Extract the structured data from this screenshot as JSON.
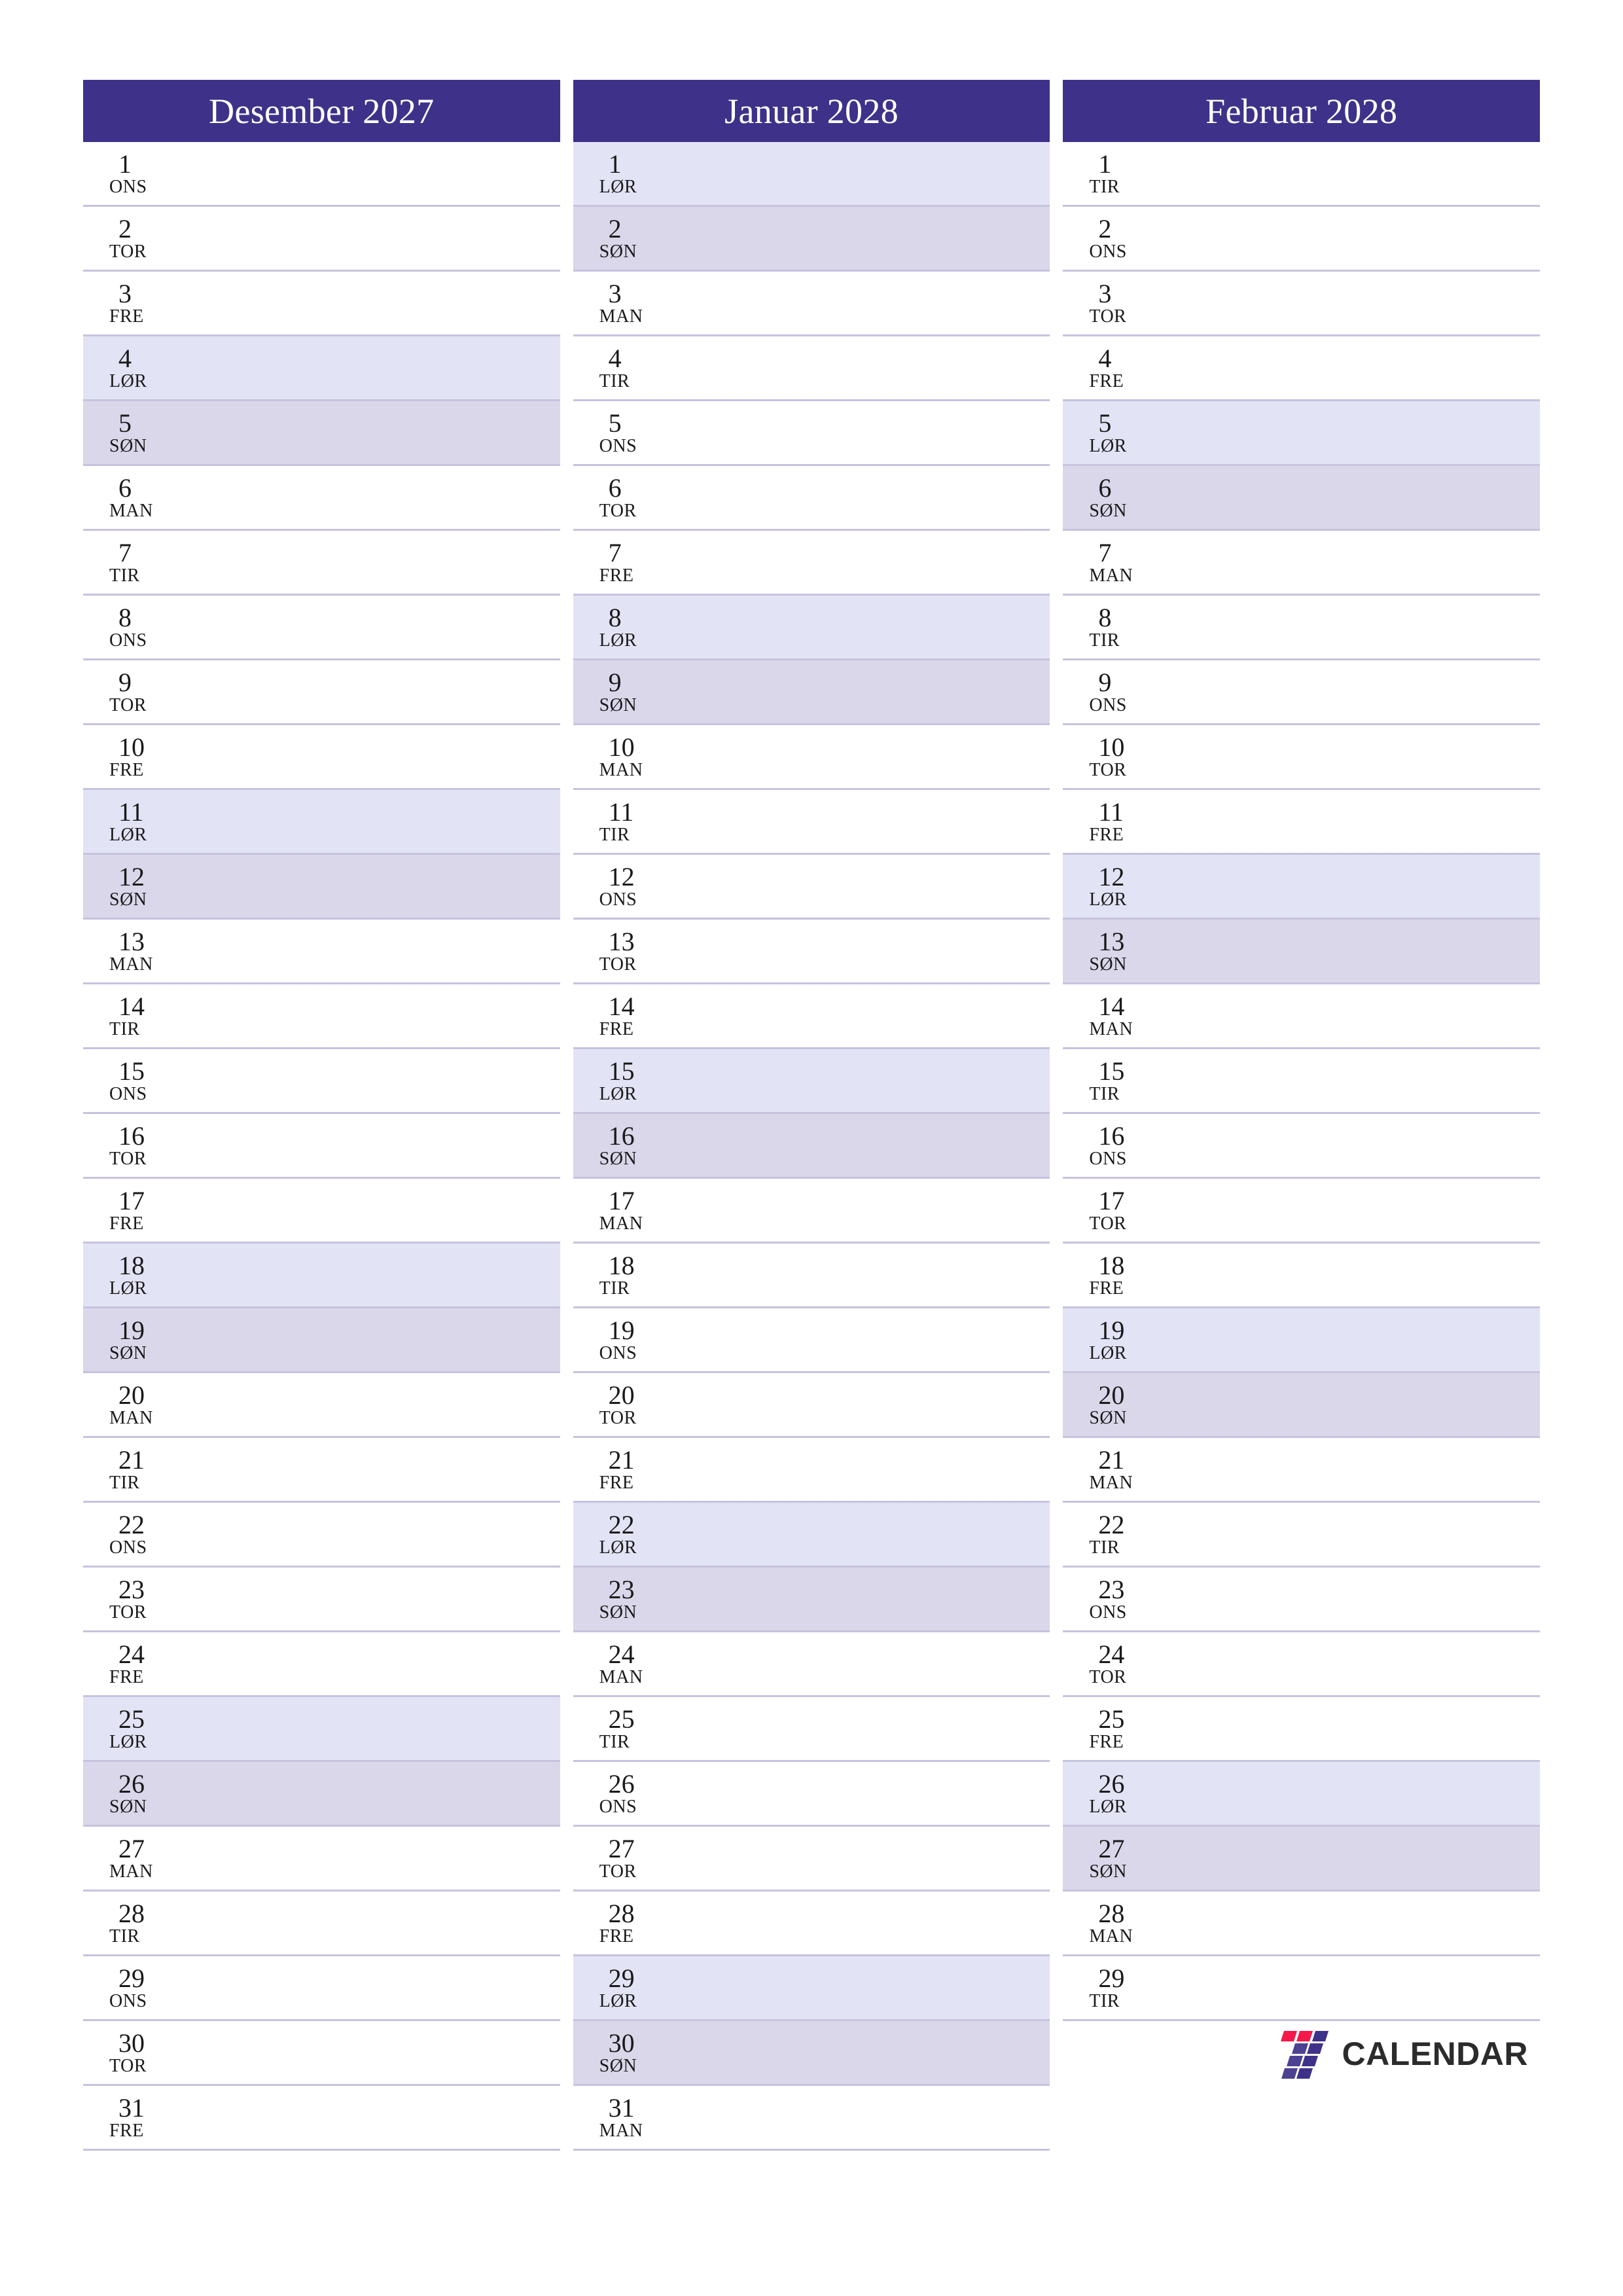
{
  "document": {
    "type": "monthly-planner-calendar",
    "language": "no",
    "orientation": "portrait"
  },
  "theme": {
    "header_bg": "#3e3189",
    "header_text": "#ffffff",
    "saturday_bg": "#e3e3f6",
    "sunday_bg": "#dad7ea",
    "row_separator": "#c5c3de",
    "body_text": "#1a1a1a",
    "logo_red": "#f5184a",
    "logo_indigo": "#3e3189",
    "logo_text": "#2b2b2b"
  },
  "logo": {
    "mark_name": "seven-stripes-mark",
    "text": "CALENDAR"
  },
  "months": [
    {
      "title": "Desember 2027",
      "name": "Desember",
      "year": "2027",
      "days": [
        {
          "num": "1",
          "weekday": "ONS",
          "kind": "weekday"
        },
        {
          "num": "2",
          "weekday": "TOR",
          "kind": "weekday"
        },
        {
          "num": "3",
          "weekday": "FRE",
          "kind": "weekday"
        },
        {
          "num": "4",
          "weekday": "LØR",
          "kind": "sat"
        },
        {
          "num": "5",
          "weekday": "SØN",
          "kind": "sun"
        },
        {
          "num": "6",
          "weekday": "MAN",
          "kind": "weekday"
        },
        {
          "num": "7",
          "weekday": "TIR",
          "kind": "weekday"
        },
        {
          "num": "8",
          "weekday": "ONS",
          "kind": "weekday"
        },
        {
          "num": "9",
          "weekday": "TOR",
          "kind": "weekday"
        },
        {
          "num": "10",
          "weekday": "FRE",
          "kind": "weekday"
        },
        {
          "num": "11",
          "weekday": "LØR",
          "kind": "sat"
        },
        {
          "num": "12",
          "weekday": "SØN",
          "kind": "sun"
        },
        {
          "num": "13",
          "weekday": "MAN",
          "kind": "weekday"
        },
        {
          "num": "14",
          "weekday": "TIR",
          "kind": "weekday"
        },
        {
          "num": "15",
          "weekday": "ONS",
          "kind": "weekday"
        },
        {
          "num": "16",
          "weekday": "TOR",
          "kind": "weekday"
        },
        {
          "num": "17",
          "weekday": "FRE",
          "kind": "weekday"
        },
        {
          "num": "18",
          "weekday": "LØR",
          "kind": "sat"
        },
        {
          "num": "19",
          "weekday": "SØN",
          "kind": "sun"
        },
        {
          "num": "20",
          "weekday": "MAN",
          "kind": "weekday"
        },
        {
          "num": "21",
          "weekday": "TIR",
          "kind": "weekday"
        },
        {
          "num": "22",
          "weekday": "ONS",
          "kind": "weekday"
        },
        {
          "num": "23",
          "weekday": "TOR",
          "kind": "weekday"
        },
        {
          "num": "24",
          "weekday": "FRE",
          "kind": "weekday"
        },
        {
          "num": "25",
          "weekday": "LØR",
          "kind": "sat"
        },
        {
          "num": "26",
          "weekday": "SØN",
          "kind": "sun"
        },
        {
          "num": "27",
          "weekday": "MAN",
          "kind": "weekday"
        },
        {
          "num": "28",
          "weekday": "TIR",
          "kind": "weekday"
        },
        {
          "num": "29",
          "weekday": "ONS",
          "kind": "weekday"
        },
        {
          "num": "30",
          "weekday": "TOR",
          "kind": "weekday"
        },
        {
          "num": "31",
          "weekday": "FRE",
          "kind": "weekday"
        }
      ]
    },
    {
      "title": "Januar 2028",
      "name": "Januar",
      "year": "2028",
      "days": [
        {
          "num": "1",
          "weekday": "LØR",
          "kind": "sat"
        },
        {
          "num": "2",
          "weekday": "SØN",
          "kind": "sun"
        },
        {
          "num": "3",
          "weekday": "MAN",
          "kind": "weekday"
        },
        {
          "num": "4",
          "weekday": "TIR",
          "kind": "weekday"
        },
        {
          "num": "5",
          "weekday": "ONS",
          "kind": "weekday"
        },
        {
          "num": "6",
          "weekday": "TOR",
          "kind": "weekday"
        },
        {
          "num": "7",
          "weekday": "FRE",
          "kind": "weekday"
        },
        {
          "num": "8",
          "weekday": "LØR",
          "kind": "sat"
        },
        {
          "num": "9",
          "weekday": "SØN",
          "kind": "sun"
        },
        {
          "num": "10",
          "weekday": "MAN",
          "kind": "weekday"
        },
        {
          "num": "11",
          "weekday": "TIR",
          "kind": "weekday"
        },
        {
          "num": "12",
          "weekday": "ONS",
          "kind": "weekday"
        },
        {
          "num": "13",
          "weekday": "TOR",
          "kind": "weekday"
        },
        {
          "num": "14",
          "weekday": "FRE",
          "kind": "weekday"
        },
        {
          "num": "15",
          "weekday": "LØR",
          "kind": "sat"
        },
        {
          "num": "16",
          "weekday": "SØN",
          "kind": "sun"
        },
        {
          "num": "17",
          "weekday": "MAN",
          "kind": "weekday"
        },
        {
          "num": "18",
          "weekday": "TIR",
          "kind": "weekday"
        },
        {
          "num": "19",
          "weekday": "ONS",
          "kind": "weekday"
        },
        {
          "num": "20",
          "weekday": "TOR",
          "kind": "weekday"
        },
        {
          "num": "21",
          "weekday": "FRE",
          "kind": "weekday"
        },
        {
          "num": "22",
          "weekday": "LØR",
          "kind": "sat"
        },
        {
          "num": "23",
          "weekday": "SØN",
          "kind": "sun"
        },
        {
          "num": "24",
          "weekday": "MAN",
          "kind": "weekday"
        },
        {
          "num": "25",
          "weekday": "TIR",
          "kind": "weekday"
        },
        {
          "num": "26",
          "weekday": "ONS",
          "kind": "weekday"
        },
        {
          "num": "27",
          "weekday": "TOR",
          "kind": "weekday"
        },
        {
          "num": "28",
          "weekday": "FRE",
          "kind": "weekday"
        },
        {
          "num": "29",
          "weekday": "LØR",
          "kind": "sat"
        },
        {
          "num": "30",
          "weekday": "SØN",
          "kind": "sun"
        },
        {
          "num": "31",
          "weekday": "MAN",
          "kind": "weekday"
        }
      ]
    },
    {
      "title": "Februar 2028",
      "name": "Februar",
      "year": "2028",
      "days": [
        {
          "num": "1",
          "weekday": "TIR",
          "kind": "weekday"
        },
        {
          "num": "2",
          "weekday": "ONS",
          "kind": "weekday"
        },
        {
          "num": "3",
          "weekday": "TOR",
          "kind": "weekday"
        },
        {
          "num": "4",
          "weekday": "FRE",
          "kind": "weekday"
        },
        {
          "num": "5",
          "weekday": "LØR",
          "kind": "sat"
        },
        {
          "num": "6",
          "weekday": "SØN",
          "kind": "sun"
        },
        {
          "num": "7",
          "weekday": "MAN",
          "kind": "weekday"
        },
        {
          "num": "8",
          "weekday": "TIR",
          "kind": "weekday"
        },
        {
          "num": "9",
          "weekday": "ONS",
          "kind": "weekday"
        },
        {
          "num": "10",
          "weekday": "TOR",
          "kind": "weekday"
        },
        {
          "num": "11",
          "weekday": "FRE",
          "kind": "weekday"
        },
        {
          "num": "12",
          "weekday": "LØR",
          "kind": "sat"
        },
        {
          "num": "13",
          "weekday": "SØN",
          "kind": "sun"
        },
        {
          "num": "14",
          "weekday": "MAN",
          "kind": "weekday"
        },
        {
          "num": "15",
          "weekday": "TIR",
          "kind": "weekday"
        },
        {
          "num": "16",
          "weekday": "ONS",
          "kind": "weekday"
        },
        {
          "num": "17",
          "weekday": "TOR",
          "kind": "weekday"
        },
        {
          "num": "18",
          "weekday": "FRE",
          "kind": "weekday"
        },
        {
          "num": "19",
          "weekday": "LØR",
          "kind": "sat"
        },
        {
          "num": "20",
          "weekday": "SØN",
          "kind": "sun"
        },
        {
          "num": "21",
          "weekday": "MAN",
          "kind": "weekday"
        },
        {
          "num": "22",
          "weekday": "TIR",
          "kind": "weekday"
        },
        {
          "num": "23",
          "weekday": "ONS",
          "kind": "weekday"
        },
        {
          "num": "24",
          "weekday": "TOR",
          "kind": "weekday"
        },
        {
          "num": "25",
          "weekday": "FRE",
          "kind": "weekday"
        },
        {
          "num": "26",
          "weekday": "LØR",
          "kind": "sat"
        },
        {
          "num": "27",
          "weekday": "SØN",
          "kind": "sun"
        },
        {
          "num": "28",
          "weekday": "MAN",
          "kind": "weekday"
        },
        {
          "num": "29",
          "weekday": "TIR",
          "kind": "weekday"
        }
      ]
    }
  ]
}
